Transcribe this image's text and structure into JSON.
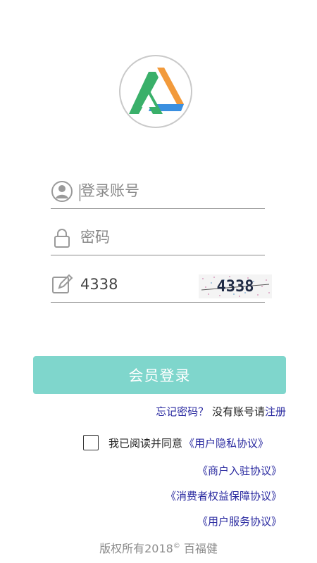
{
  "login": {
    "account_placeholder": "登录账号",
    "password_placeholder": "密码",
    "captcha_value": "4338",
    "captcha_image_text": "4338",
    "login_button": "会员登录"
  },
  "help": {
    "forgot": "忘记密码？",
    "no_account": "没有账号请",
    "register": "注册"
  },
  "agreement": {
    "text": "我已阅读并同意",
    "privacy": "《用户隐私协议》",
    "merchant": "《商户入驻协议》",
    "consumer": "《消费者权益保障协议》",
    "service": "《用户服务协议》"
  },
  "footer": {
    "prefix": "版权所有2018",
    "symbol": "©",
    "company": "百福健"
  },
  "colors": {
    "button": "#7fd6cc",
    "link": "#2a2aa0",
    "logo_green": "#3ab06a",
    "logo_orange": "#f29a3b",
    "logo_blue": "#3a8fe0"
  }
}
